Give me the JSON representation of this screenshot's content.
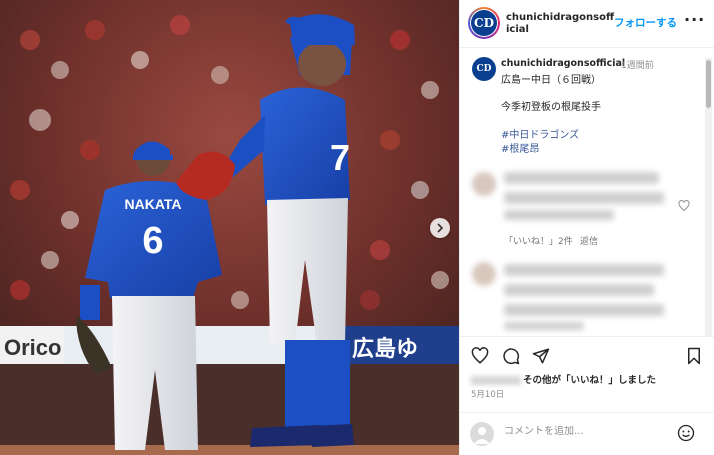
{
  "post": {
    "account": "chunichidragonsofficial",
    "follow_label": "フォローする",
    "dot": "•",
    "more": "···",
    "logo_text": "CD",
    "caption": {
      "user": "chunichidragonsofficial",
      "time": "1週間前",
      "line1": "広島ー中日（６回戦）",
      "line2": "今季初登板の根尾投手",
      "hashtags": [
        "#中日ドラゴンズ",
        "#根尾昂"
      ]
    },
    "comments": [
      {
        "likes_label": "「いいね！」2件",
        "reply_label": "返信"
      }
    ],
    "likes_suffix": "その他が「いいね！」しました",
    "date": "5月10日",
    "comment_placeholder": "コメントを追加...",
    "icons": {
      "next": "chevron-right-icon",
      "heart": "heart-icon",
      "comment": "comment-icon",
      "share": "paper-plane-icon",
      "bookmark": "bookmark-icon",
      "emoji": "smiley-icon"
    }
  },
  "photo": {
    "player_back_name": "NAKATA",
    "player_back_number": "6",
    "sign_left": "Orico",
    "sign_right": "広島ゆ"
  },
  "colors": {
    "link": "#0095f6",
    "hashtag": "#385898",
    "jersey": "#1d4fc4",
    "dragons_blue": "#0a3e8f"
  }
}
